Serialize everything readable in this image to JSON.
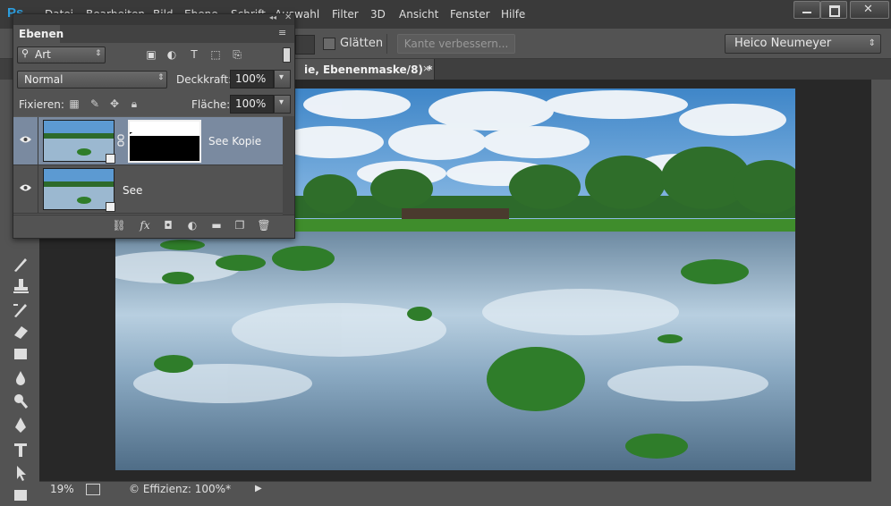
{
  "app": {
    "logo_text": "Ps",
    "menu": [
      "Datei",
      "Bearbeiten",
      "Bild",
      "Ebene",
      "Schrift",
      "Auswahl",
      "Filter",
      "3D",
      "Ansicht",
      "Fenster",
      "Hilfe"
    ]
  },
  "options_bar": {
    "smooth_label": "Glätten",
    "refine_edge_label": "Kante verbessern...",
    "workspace": "Heico Neumeyer"
  },
  "document_tab": {
    "title": "ie, Ebenenmaske/8) *",
    "close": "×"
  },
  "layers_panel": {
    "tab_label": "Ebenen",
    "filter_kind": "Art",
    "blend_mode": "Normal",
    "opacity_label": "Deckkraft:",
    "opacity_value": "100%",
    "lock_label": "Fixieren:",
    "fill_label": "Fläche:",
    "fill_value": "100%",
    "layers": [
      {
        "name": "See Kopie",
        "has_mask": true,
        "visible": true,
        "selected": true
      },
      {
        "name": "See",
        "has_mask": false,
        "visible": true,
        "selected": false
      }
    ]
  },
  "status_bar": {
    "zoom": "19%",
    "info": "© Effizienz: 100%*"
  },
  "colors": {
    "selected_layer": "#7a8aa0",
    "panel_bg": "#535353",
    "canvas_bg": "#282828",
    "logo": "#2d9fe0"
  }
}
